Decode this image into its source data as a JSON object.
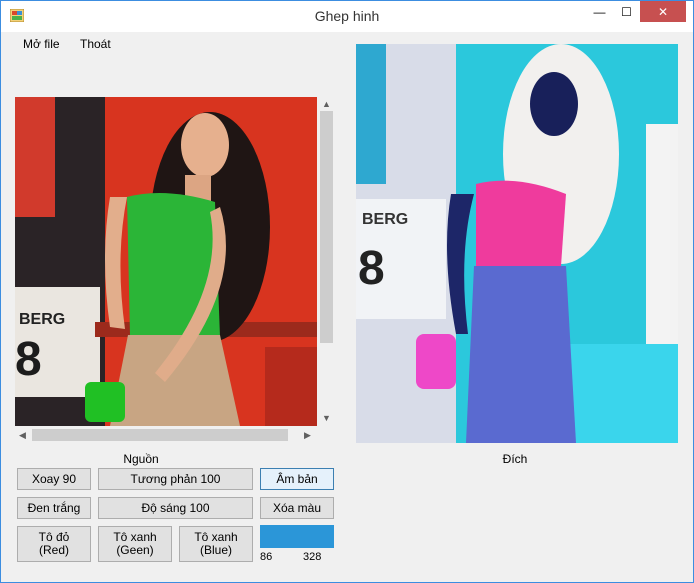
{
  "window": {
    "title": "Ghep hinh",
    "controls": {
      "minimize": "—",
      "maximize": "☐",
      "close": "✕"
    }
  },
  "menu": {
    "items": [
      {
        "label": "Mở file"
      },
      {
        "label": "Thoát"
      }
    ]
  },
  "source": {
    "caption": "Nguồn"
  },
  "destination": {
    "caption": "Đích"
  },
  "buttons": {
    "rotate": "Xoay 90",
    "contrast": "Tương phản 100",
    "negative": "Âm bản",
    "grayscale": "Đen trắng",
    "brightness": "Độ sáng 100",
    "remove_color": "Xóa màu",
    "paint_red": "Tô đỏ\n(Red)",
    "paint_green": "Tô xanh\n(Geen)",
    "paint_blue": "Tô xanh\n(Blue)"
  },
  "color_picker": {
    "color": "#2b96d8",
    "value_left": "86",
    "value_right": "328"
  },
  "icons": {
    "scroll_up": "chevron-up-icon",
    "scroll_down": "chevron-down-icon",
    "scroll_left": "chevron-left-icon",
    "scroll_right": "chevron-right-icon"
  }
}
